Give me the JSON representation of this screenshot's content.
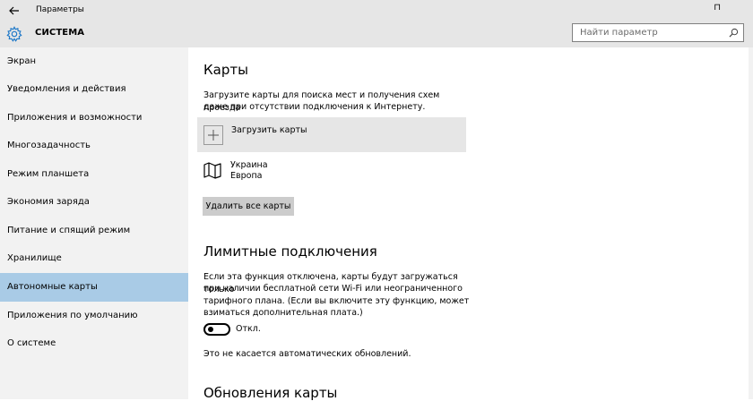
{
  "window": {
    "title": "Параметры",
    "controls": "⊓"
  },
  "header": {
    "section_title": "СИСТЕМА",
    "search_placeholder": "Найти параметр"
  },
  "sidebar": {
    "items": [
      {
        "label": "Экран"
      },
      {
        "label": "Уведомления и действия"
      },
      {
        "label": "Приложения и возможности"
      },
      {
        "label": "Многозадачность"
      },
      {
        "label": "Режим планшета"
      },
      {
        "label": "Экономия заряда"
      },
      {
        "label": "Питание и спящий режим"
      },
      {
        "label": "Хранилище"
      },
      {
        "label": "Автономные карты",
        "active": true
      },
      {
        "label": "Приложения по умолчанию"
      },
      {
        "label": "О системе"
      }
    ]
  },
  "main": {
    "maps_heading": "Карты",
    "maps_description_line1": "Загрузите карты для поиска мест и получения схем проезда",
    "maps_description_line2": "даже при отсутствии подключения к Интернету.",
    "download_label": "Загрузить карты",
    "map_entry": {
      "line1": "Украина",
      "line2": "Европа"
    },
    "delete_all_label": "Удалить все карты",
    "metered_heading": "Лимитные подключения",
    "metered_description_line1": "Если эта функция отключена, карты будут загружаться только",
    "metered_description_line2": "при наличии бесплатной сети Wi-Fi или неограниченного",
    "metered_description_line3": "тарифного плана. (Если вы включите эту функцию, может",
    "metered_description_line4": "взиматься дополнительная плата.)",
    "toggle_state": "Откл.",
    "toggle_on": false,
    "auto_update_note": "Это не касается автоматических обновлений.",
    "updates_heading": "Обновления карты"
  },
  "colors": {
    "chrome": "#e6e6e6",
    "sidebar": "#f2f2f2",
    "active_item": "#a9cbe6",
    "button": "#cccccc",
    "accent_icon": "#1e78c8"
  },
  "icons": {
    "back": "back-arrow-icon",
    "settings": "gear-icon",
    "search": "search-icon",
    "add": "plus-icon",
    "map": "map-icon"
  }
}
